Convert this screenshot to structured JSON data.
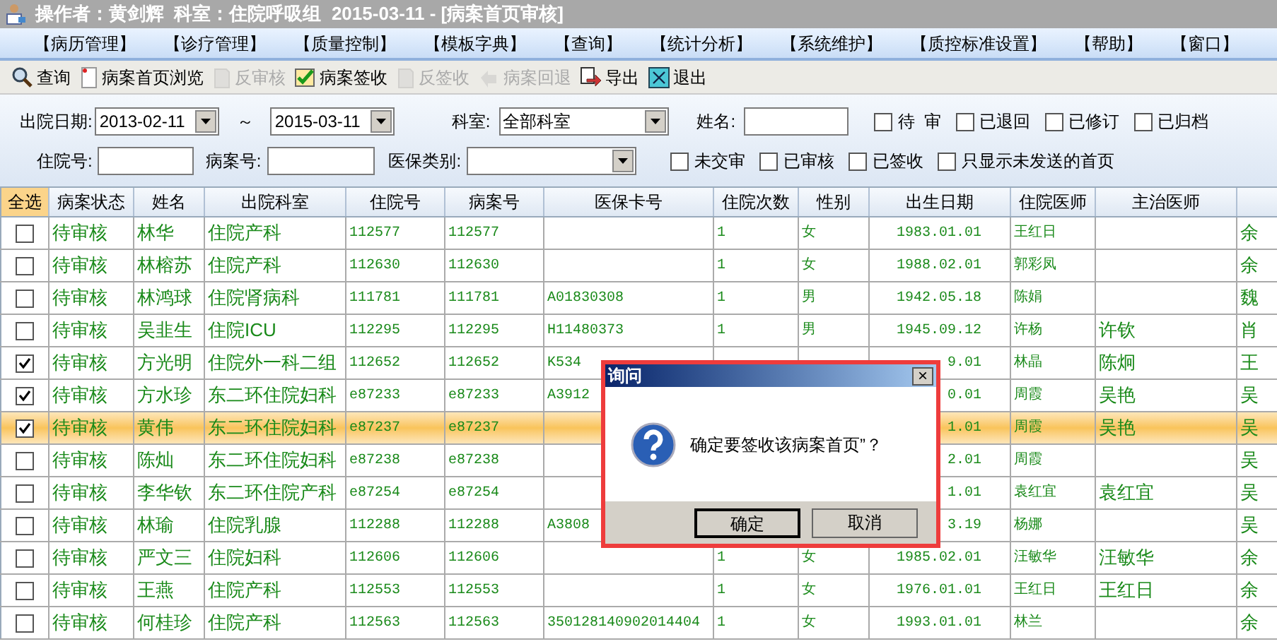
{
  "window": {
    "title": "操作者：黄剑辉  科室：住院呼吸组  2015-03-11 - [病案首页审核]"
  },
  "menu": [
    "【病历管理】",
    "【诊疗管理】",
    "【质量控制】",
    "【模板字典】",
    "【查询】",
    "【统计分析】",
    "【系统维护】",
    "【质控标准设置】",
    "【帮助】",
    "【窗口】"
  ],
  "toolbar": [
    {
      "label": "查询",
      "kind": "search",
      "disabled": false
    },
    {
      "label": "病案首页浏览",
      "kind": "page",
      "disabled": false
    },
    {
      "label": "反审核",
      "kind": "doc",
      "disabled": true
    },
    {
      "label": "病案签收",
      "kind": "check",
      "disabled": false
    },
    {
      "label": "反签收",
      "kind": "doc",
      "disabled": true
    },
    {
      "label": "病案回退",
      "kind": "back",
      "disabled": true
    },
    {
      "label": "导出",
      "kind": "export",
      "disabled": false
    },
    {
      "label": "退出",
      "kind": "exit",
      "disabled": false
    }
  ],
  "filters": {
    "discharge_date_label": "出院日期:",
    "date_from": "2013-02-11",
    "tilde": "～",
    "date_to": "2015-03-11",
    "dept_label": "科室:",
    "dept": "全部科室",
    "name_label": "姓名:",
    "inpatient_no_label": "住院号:",
    "case_no_label": "病案号:",
    "insurance_label": "医保类别:",
    "checks_row1": [
      {
        "label": "待  审",
        "checked": false
      },
      {
        "label": "已退回",
        "checked": false
      },
      {
        "label": "已修订",
        "checked": false
      },
      {
        "label": "已归档",
        "checked": false
      }
    ],
    "checks_row2": [
      {
        "label": "未交审",
        "checked": false
      },
      {
        "label": "已审核",
        "checked": false
      },
      {
        "label": "已签收",
        "checked": false
      },
      {
        "label": "只显示未发送的首页",
        "checked": false
      }
    ]
  },
  "table": {
    "select_all": "全选",
    "columns": [
      "病案状态",
      "姓名",
      "出院科室",
      "住院号",
      "病案号",
      "医保卡号",
      "住院次数",
      "性别",
      "出生日期",
      "住院医师",
      "主治医师"
    ],
    "rows": [
      {
        "checked": false,
        "selected": false,
        "cells": [
          "待审核",
          "林华",
          "住院产科",
          "112577",
          "112577",
          "",
          "1",
          "女",
          "1983.01.01",
          "王红日",
          "",
          "余"
        ]
      },
      {
        "checked": false,
        "selected": false,
        "cells": [
          "待审核",
          "林榕苏",
          "住院产科",
          "112630",
          "112630",
          "",
          "1",
          "女",
          "1988.02.01",
          "郭彩凤",
          "",
          "余"
        ]
      },
      {
        "checked": false,
        "selected": false,
        "cells": [
          "待审核",
          "林鸿球",
          "住院肾病科",
          "111781",
          "111781",
          "A01830308",
          "1",
          "男",
          "1942.05.18",
          "陈娟",
          "",
          "魏"
        ]
      },
      {
        "checked": false,
        "selected": false,
        "cells": [
          "待审核",
          "吴韭生",
          "住院ICU",
          "112295",
          "112295",
          "H11480373",
          "1",
          "男",
          "1945.09.12",
          "许杨",
          "许钦",
          "肖"
        ]
      },
      {
        "checked": true,
        "selected": false,
        "cells": [
          "待审核",
          "方光明",
          "住院外一科二组",
          "112652",
          "112652",
          "K534",
          "",
          "",
          "9.01",
          "林晶",
          "陈炯",
          "王"
        ]
      },
      {
        "checked": true,
        "selected": false,
        "cells": [
          "待审核",
          "方水珍",
          "东二环住院妇科",
          "e87233",
          "e87233",
          "A3912",
          "",
          "",
          "0.01",
          "周霞",
          "吴艳",
          "吴"
        ]
      },
      {
        "checked": true,
        "selected": true,
        "cells": [
          "待审核",
          "黄伟",
          "东二环住院妇科",
          "e87237",
          "e87237",
          "",
          "",
          "",
          "1.01",
          "周霞",
          "吴艳",
          "吴"
        ]
      },
      {
        "checked": false,
        "selected": false,
        "cells": [
          "待审核",
          "陈灿",
          "东二环住院妇科",
          "e87238",
          "e87238",
          "",
          "",
          "",
          "2.01",
          "周霞",
          "",
          "吴"
        ]
      },
      {
        "checked": false,
        "selected": false,
        "cells": [
          "待审核",
          "李华钦",
          "东二环住院产科",
          "e87254",
          "e87254",
          "",
          "",
          "",
          "1.01",
          "袁红宜",
          "袁红宜",
          "吴"
        ]
      },
      {
        "checked": false,
        "selected": false,
        "cells": [
          "待审核",
          "林瑜",
          "住院乳腺",
          "112288",
          "112288",
          "A3808",
          "",
          "",
          "3.19",
          "杨娜",
          "",
          "吴"
        ]
      },
      {
        "checked": false,
        "selected": false,
        "cells": [
          "待审核",
          "严文三",
          "住院妇科",
          "112606",
          "112606",
          "",
          "1",
          "女",
          "1985.02.01",
          "汪敏华",
          "汪敏华",
          "余"
        ]
      },
      {
        "checked": false,
        "selected": false,
        "cells": [
          "待审核",
          "王燕",
          "住院产科",
          "112553",
          "112553",
          "",
          "1",
          "女",
          "1976.01.01",
          "王红日",
          "王红日",
          "余"
        ]
      },
      {
        "checked": false,
        "selected": false,
        "cells": [
          "待审核",
          "何桂珍",
          "住院产科",
          "112563",
          "112563",
          "350128140902014404",
          "1",
          "女",
          "1993.01.01",
          "林兰",
          "",
          "余"
        ]
      }
    ]
  },
  "dialog": {
    "title": "询问",
    "close": "×",
    "message": "确定要签收该病案首页”？",
    "buttons": [
      {
        "label": "确定",
        "default": true
      },
      {
        "label": "取消",
        "default": false
      }
    ]
  }
}
